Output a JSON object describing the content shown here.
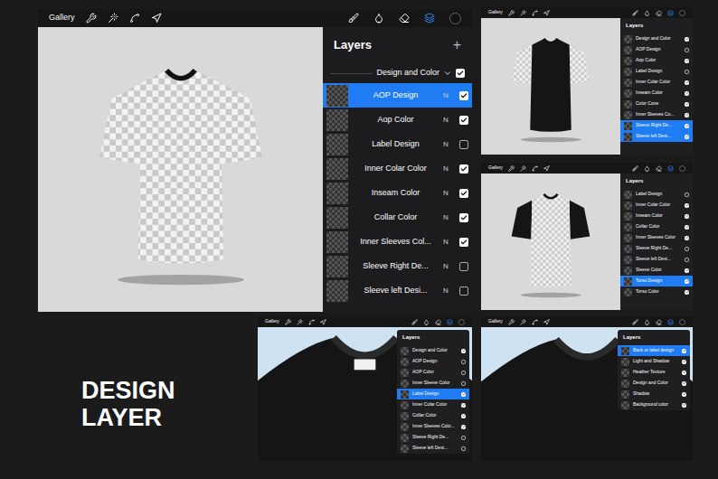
{
  "main": {
    "toolbar": {
      "gallery": "Gallery"
    },
    "shirt": {
      "torso": "checker",
      "sleeves": "checker"
    },
    "layers": {
      "title": "Layers",
      "add": "+",
      "group": {
        "name": "Design and Color",
        "checked": true,
        "expanded": true
      },
      "rows": [
        {
          "name": "AOP Design",
          "blend": "N",
          "visible": true,
          "selected": true
        },
        {
          "name": "Aop Color",
          "blend": "N",
          "visible": true,
          "selected": false
        },
        {
          "name": "Label Design",
          "blend": "N",
          "visible": false,
          "selected": false
        },
        {
          "name": "Inner Colar Color",
          "blend": "N",
          "visible": true,
          "selected": false
        },
        {
          "name": "Inseam Color",
          "blend": "N",
          "visible": true,
          "selected": false
        },
        {
          "name": "Collar Color",
          "blend": "N",
          "visible": true,
          "selected": false
        },
        {
          "name": "Inner Sleeves Col...",
          "blend": "N",
          "visible": true,
          "selected": false
        },
        {
          "name": "Sleeve Right De...",
          "blend": "N",
          "visible": false,
          "selected": false
        },
        {
          "name": "Sleeve left Desi...",
          "blend": "N",
          "visible": false,
          "selected": false
        }
      ]
    }
  },
  "thumbnails": [
    {
      "view": "full",
      "toolbar": {
        "gallery": "Gallery"
      },
      "shirt": {
        "torso": "black",
        "sleeves": "checker",
        "label": false
      },
      "layers": {
        "title": "Layers",
        "rows": [
          {
            "name": "Design and Color",
            "visible": true,
            "selected": false
          },
          {
            "name": "AOP Design",
            "visible": false,
            "selected": false
          },
          {
            "name": "Aop Color",
            "visible": true,
            "selected": false
          },
          {
            "name": "Label Design",
            "visible": false,
            "selected": false
          },
          {
            "name": "Inner Colar Color",
            "visible": true,
            "selected": false
          },
          {
            "name": "Inseam Color",
            "visible": true,
            "selected": false
          },
          {
            "name": "Color Cone",
            "visible": true,
            "selected": false
          },
          {
            "name": "Inner Sleeves Co...",
            "visible": true,
            "selected": false
          },
          {
            "name": "Sleeve Right De...",
            "visible": true,
            "selected": true
          },
          {
            "name": "Sleeve left Desi...",
            "visible": true,
            "selected": true
          }
        ]
      }
    },
    {
      "view": "full",
      "toolbar": {
        "gallery": "Gallery"
      },
      "shirt": {
        "torso": "checker",
        "sleeves": "black",
        "label": false
      },
      "layers": {
        "title": "Layers",
        "rows": [
          {
            "name": "Label Design",
            "visible": false,
            "selected": false
          },
          {
            "name": "Inner Colar Color",
            "visible": true,
            "selected": false
          },
          {
            "name": "Inseam Color",
            "visible": true,
            "selected": false
          },
          {
            "name": "Collar Color",
            "visible": true,
            "selected": false
          },
          {
            "name": "Inner Sleeves Color",
            "visible": true,
            "selected": false
          },
          {
            "name": "Sleeve Right De...",
            "visible": false,
            "selected": false
          },
          {
            "name": "Sleeve left Desi...",
            "visible": false,
            "selected": false
          },
          {
            "name": "Sleeve Color",
            "visible": true,
            "selected": false
          },
          {
            "name": "Torso Design",
            "visible": true,
            "selected": true
          },
          {
            "name": "Torso Color",
            "visible": true,
            "selected": false
          }
        ]
      }
    },
    {
      "view": "collar",
      "toolbar": {
        "gallery": "Gallery"
      },
      "shirt": {
        "torso": "black",
        "sleeves": "black",
        "label": true
      },
      "layers": {
        "title": "Layers",
        "rows": [
          {
            "name": "Design and Color",
            "visible": true,
            "selected": false
          },
          {
            "name": "AOP Design",
            "visible": false,
            "selected": false
          },
          {
            "name": "AOP Color",
            "visible": false,
            "selected": false
          },
          {
            "name": "Inner Sleeve Color",
            "visible": false,
            "selected": false
          },
          {
            "name": "Label Design",
            "visible": true,
            "selected": true
          },
          {
            "name": "Inner Colar Color",
            "visible": true,
            "selected": false
          },
          {
            "name": "Collar Color",
            "visible": true,
            "selected": false
          },
          {
            "name": "Inner Sleeves Colo...",
            "visible": true,
            "selected": false
          },
          {
            "name": "Sleeve Right De...",
            "visible": false,
            "selected": false
          },
          {
            "name": "Sleeve left Desi...",
            "visible": false,
            "selected": false
          }
        ]
      }
    },
    {
      "view": "collar",
      "toolbar": {
        "gallery": "Gallery"
      },
      "shirt": {
        "torso": "black",
        "sleeves": "black",
        "label": false
      },
      "layers": {
        "title": "Layers",
        "rows": [
          {
            "name": "Back or label design",
            "visible": true,
            "selected": true
          },
          {
            "name": "Light and Shadow",
            "visible": true,
            "selected": false
          },
          {
            "name": "Heather Texture",
            "visible": true,
            "selected": false
          },
          {
            "name": "Design and Color",
            "visible": true,
            "selected": false
          },
          {
            "name": "Shadow",
            "visible": true,
            "selected": false
          },
          {
            "name": "Background color",
            "visible": true,
            "selected": false
          }
        ]
      }
    }
  ],
  "headline": [
    "DESIGN",
    "LAYER"
  ]
}
